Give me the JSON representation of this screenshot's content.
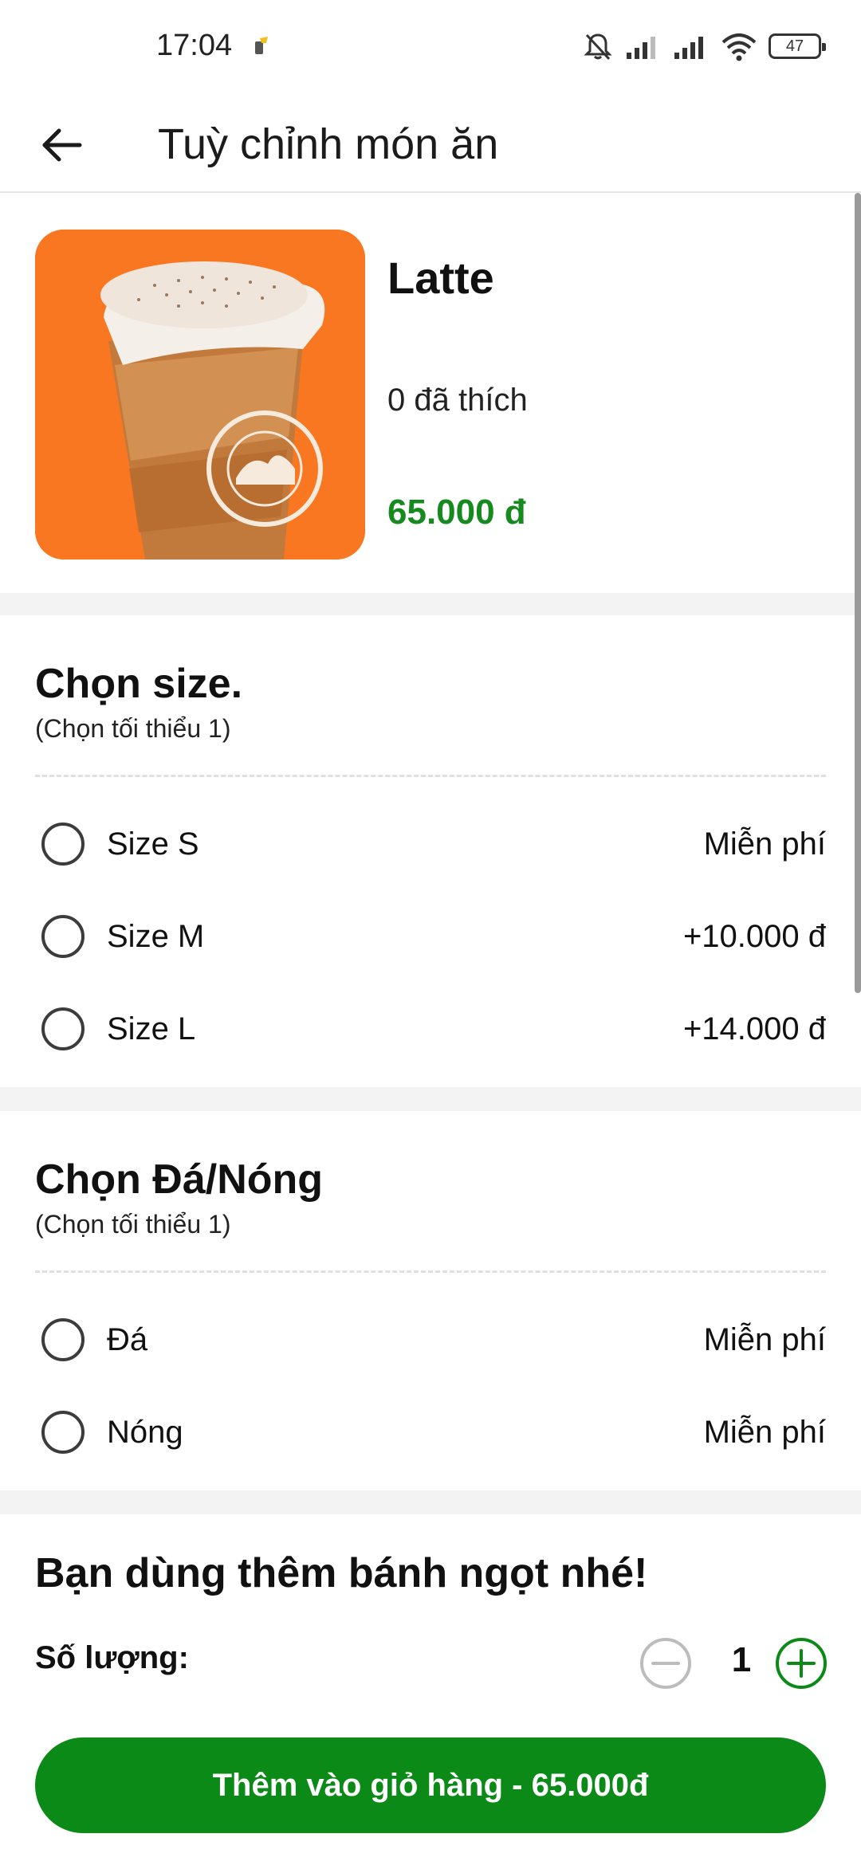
{
  "status_bar": {
    "time": "17:04",
    "battery": "47",
    "icons": [
      "notification-mute-icon",
      "signal-icon",
      "signal-icon",
      "wifi-icon",
      "battery-icon"
    ]
  },
  "header": {
    "title": "Tuỳ chỉnh món ăn",
    "back_icon": "arrow-left-icon"
  },
  "product": {
    "name": "Latte",
    "likes": "0 đã thích",
    "price": "65.000 đ",
    "image_brand": "HIGHLANDS COFFEE"
  },
  "sections": [
    {
      "title": "Chọn size.",
      "subtitle": "(Chọn tối thiểu 1)",
      "options": [
        {
          "label": "Size S",
          "price": "Miễn phí",
          "selected": false
        },
        {
          "label": "Size M",
          "price": "+10.000 đ",
          "selected": false
        },
        {
          "label": "Size L",
          "price": "+14.000 đ",
          "selected": false
        }
      ]
    },
    {
      "title": "Chọn Đá/Nóng",
      "subtitle": "(Chọn tối thiểu 1)",
      "options": [
        {
          "label": "Đá",
          "price": "Miễn phí",
          "selected": false
        },
        {
          "label": "Nóng",
          "price": "Miễn phí",
          "selected": false
        }
      ]
    },
    {
      "title": "Bạn dùng thêm bánh ngọt nhé!"
    }
  ],
  "quantity": {
    "label": "Số lượng:",
    "value": "1"
  },
  "cart_button": {
    "label": "Thêm vào giỏ hàng - 65.000đ"
  },
  "colors": {
    "accent": "#0b8a18",
    "price": "#16891f",
    "image_background": "#fa7722"
  }
}
